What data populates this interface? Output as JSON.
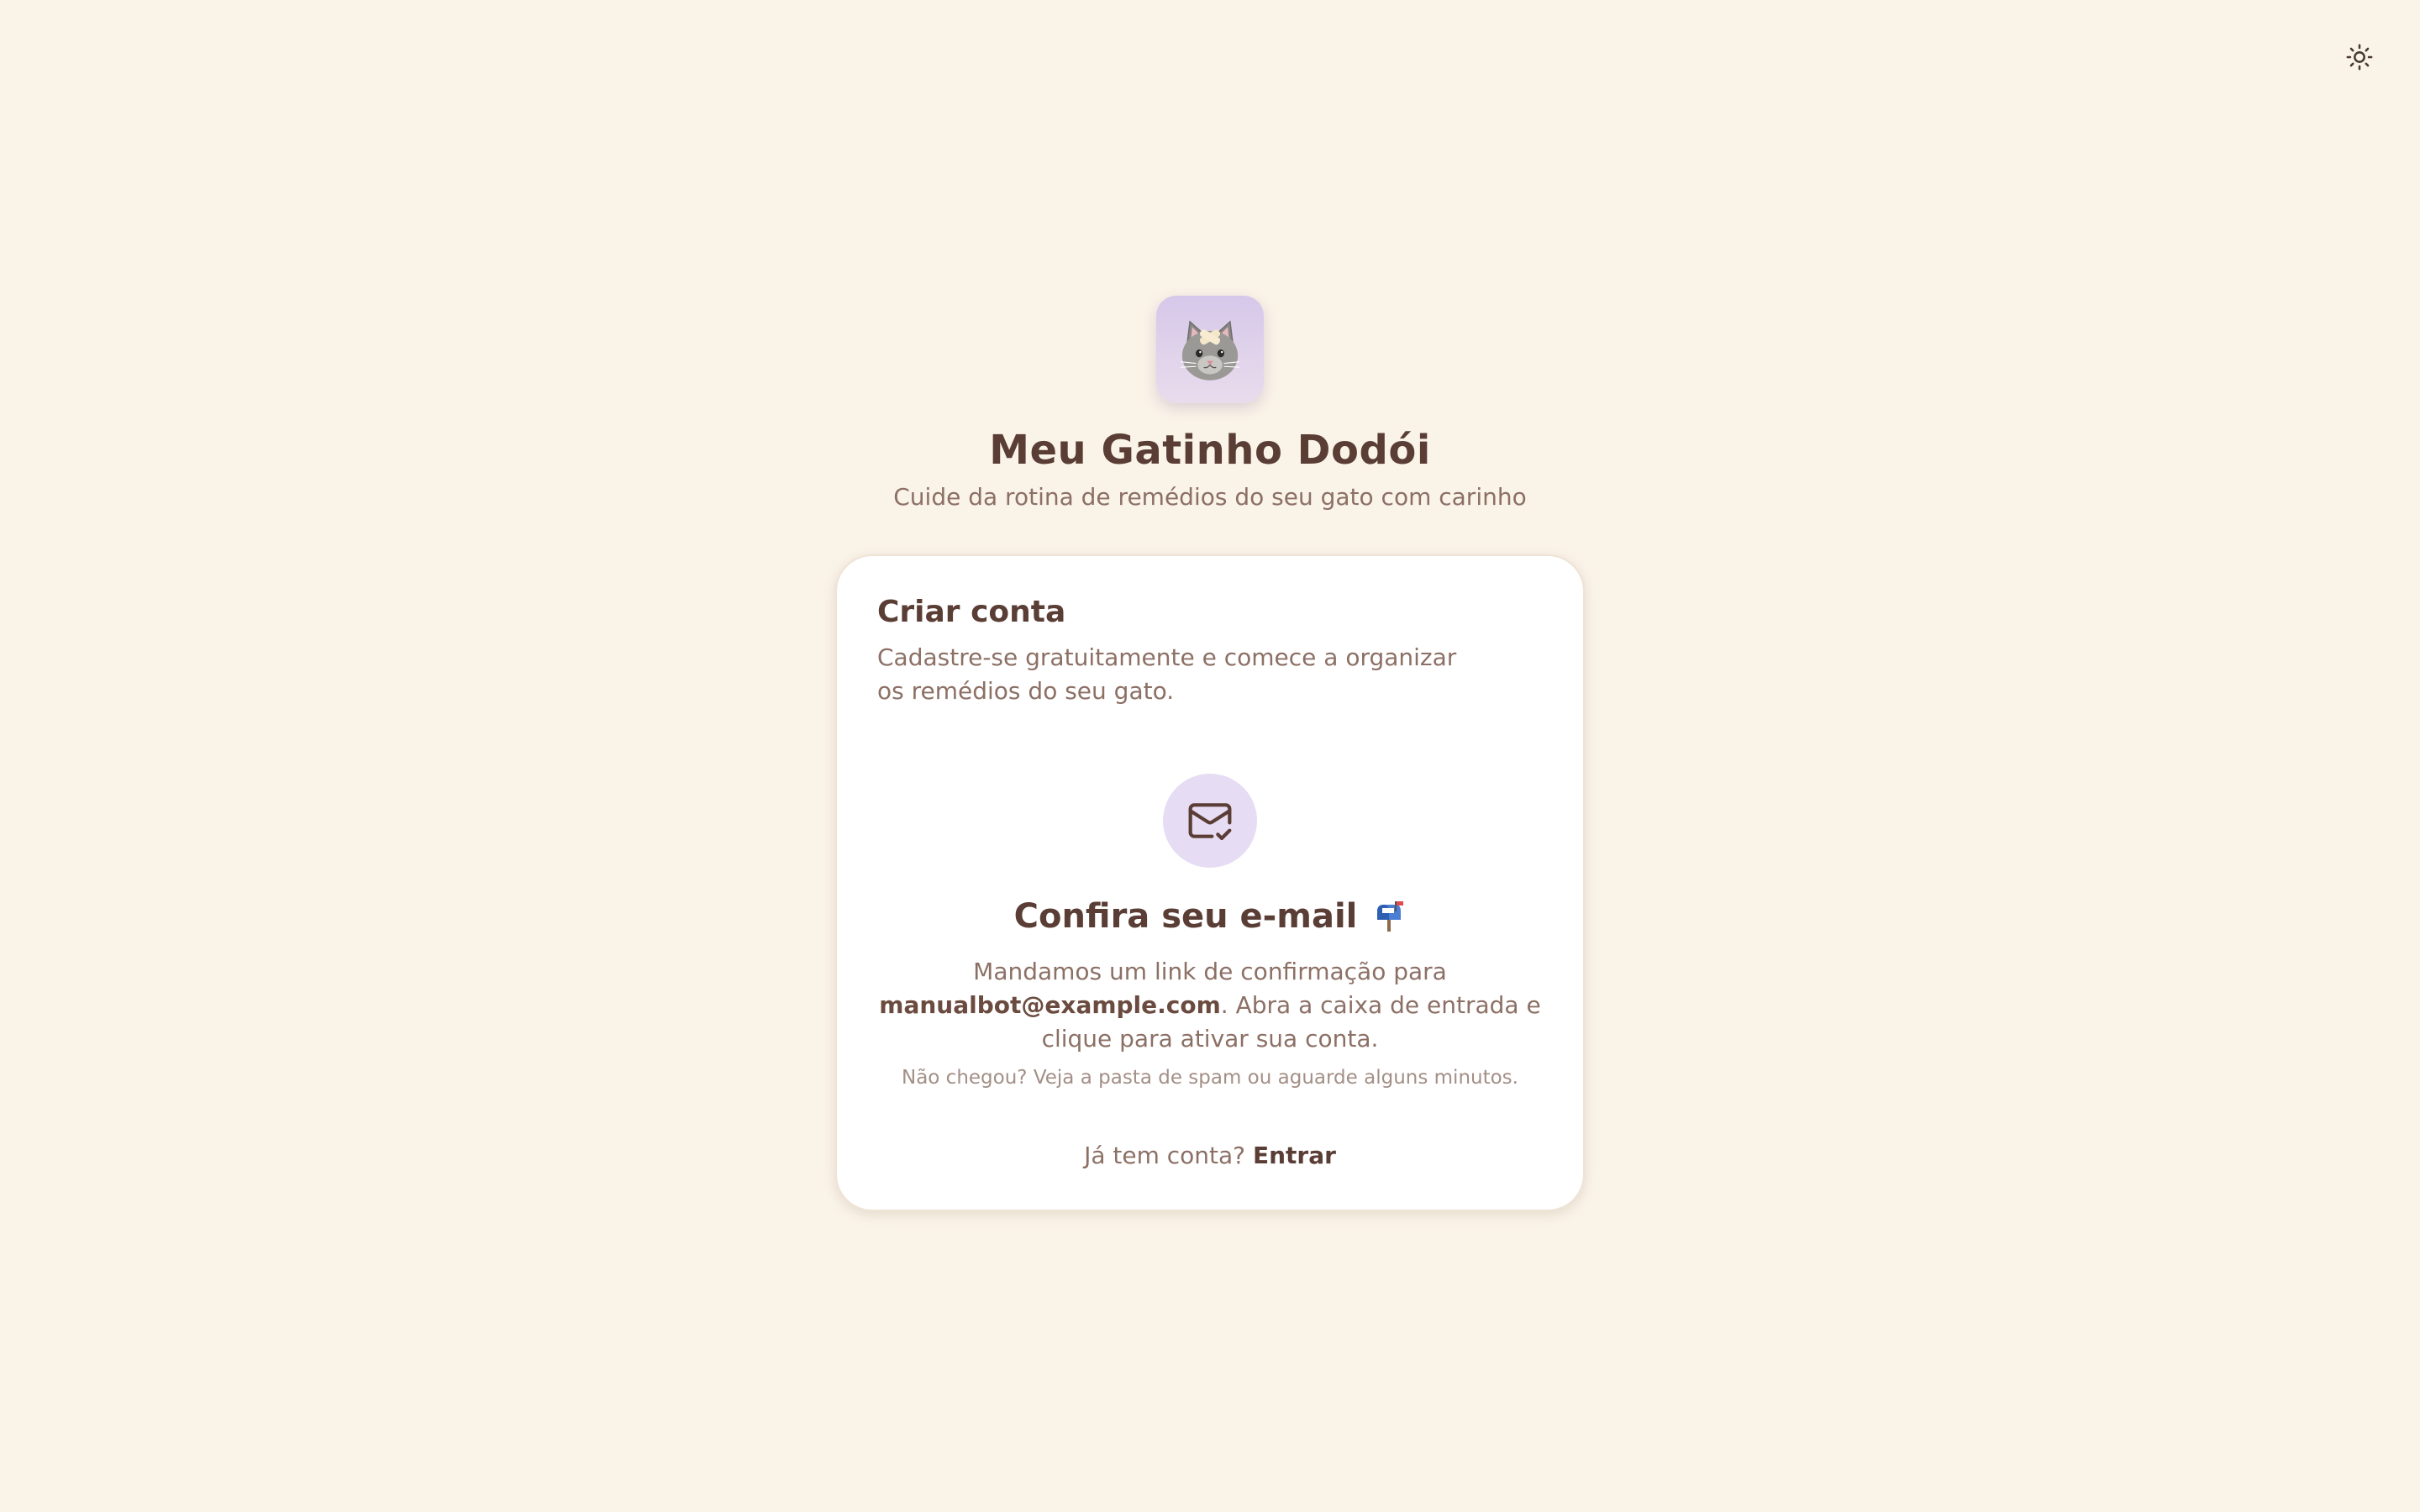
{
  "header": {
    "theme_toggle_icon": "sun-icon"
  },
  "app": {
    "logo_icon": "bandaged-cat-icon",
    "title": "Meu Gatinho Dodói",
    "subtitle": "Cuide da rotina de remédios do seu gato com carinho"
  },
  "card": {
    "title": "Criar conta",
    "description": "Cadastre-se gratuitamente e comece a organizar os remédios do seu gato.",
    "confirmation": {
      "icon": "mail-check-icon",
      "title": "Confira seu e-mail",
      "title_emoji": "mailbox-icon",
      "text_before": "Mandamos um link de confirmação para ",
      "email": "manualbot@example.com",
      "text_after": ". Abra a caixa de entrada e clique para ativar sua conta.",
      "hint": "Não chegou? Veja a pasta de spam ou aguarde alguns minutos."
    },
    "login_prompt": "Já tem conta?",
    "login_link": "Entrar"
  },
  "colors": {
    "background": "#faf3e8",
    "card": "#ffffff",
    "text_primary": "#5a3e36",
    "text_secondary": "#8c7065",
    "accent_lavender": "#e6dcf4"
  }
}
